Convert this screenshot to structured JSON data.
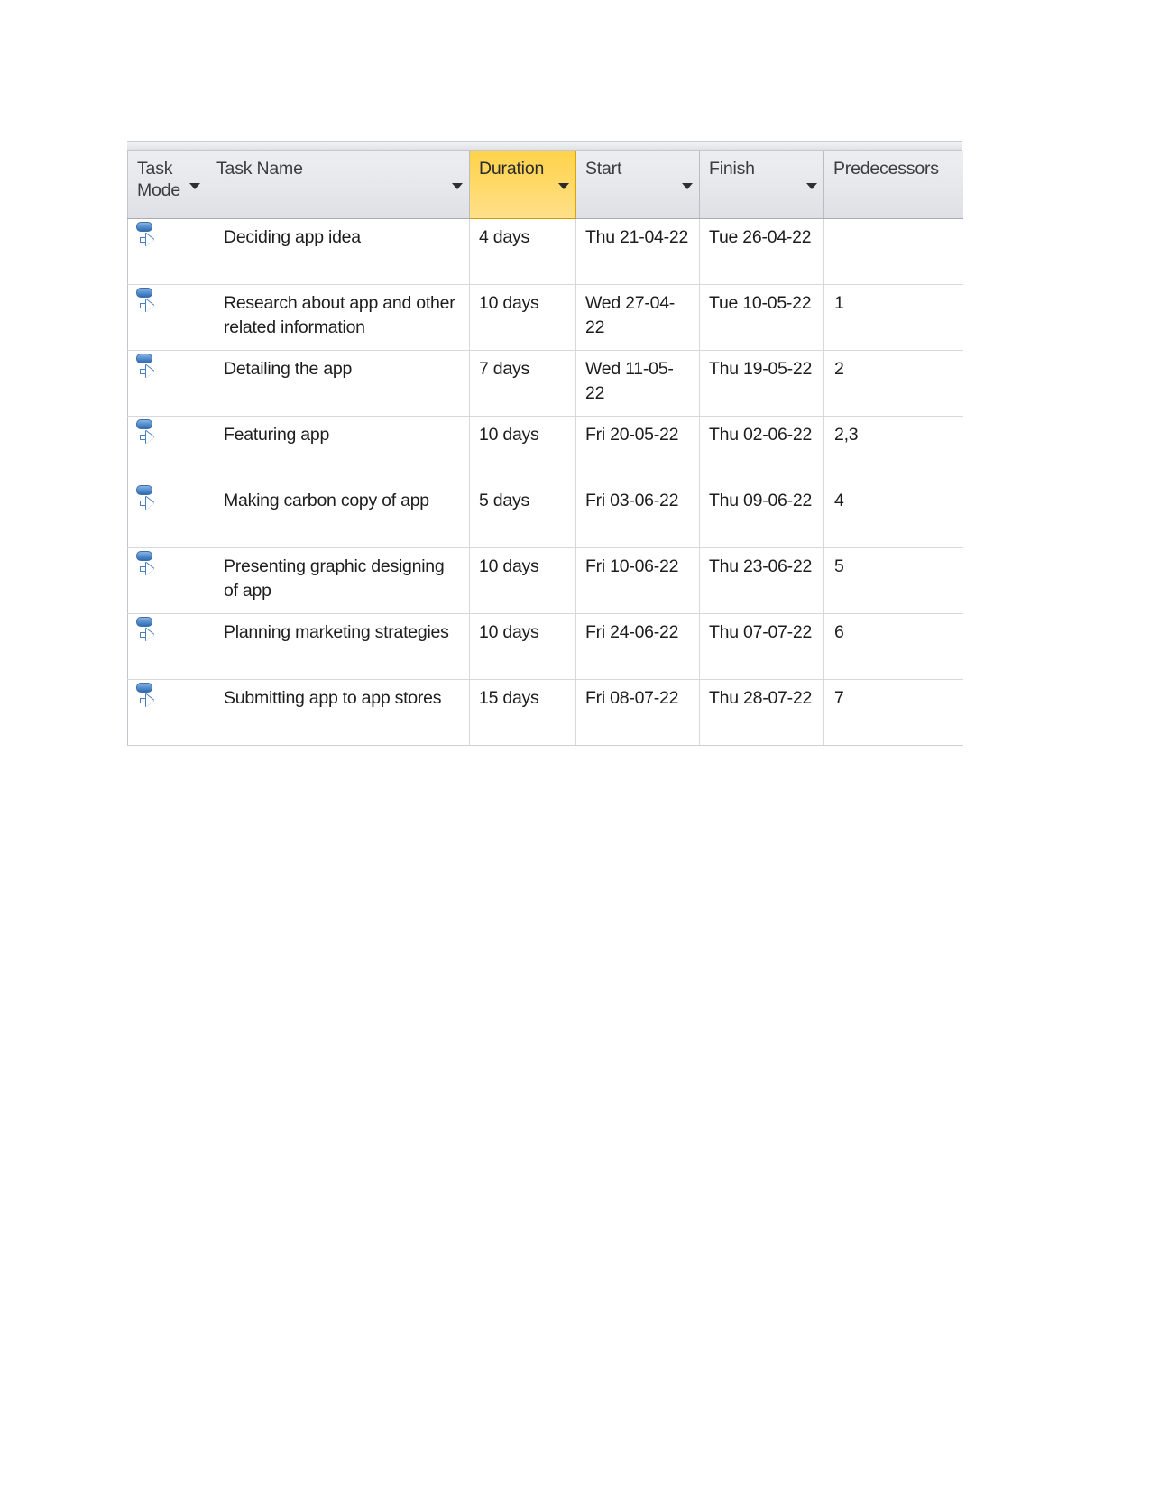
{
  "grid": {
    "columns": [
      {
        "key": "task_mode",
        "label": "Task Mode",
        "highlighted": false,
        "has_filter": true
      },
      {
        "key": "task_name",
        "label": "Task Name",
        "highlighted": false,
        "has_filter": true
      },
      {
        "key": "duration",
        "label": "Duration",
        "highlighted": true,
        "has_filter": true
      },
      {
        "key": "start",
        "label": "Start",
        "highlighted": false,
        "has_filter": true
      },
      {
        "key": "finish",
        "label": "Finish",
        "highlighted": false,
        "has_filter": true
      },
      {
        "key": "predecessors",
        "label": "Predecessors",
        "highlighted": false,
        "has_filter": true
      }
    ],
    "selected_column": "Duration",
    "accent_color": "#FFD24A",
    "header_background": "#E6E8EC",
    "gridline_color": "#D6D8DC",
    "task_mode_icon": "auto-scheduled-icon",
    "rows": [
      {
        "task_mode": "auto-scheduled-icon",
        "task_name": "Deciding app idea",
        "duration": "4 days",
        "start": "Thu 21-04-22",
        "finish": "Tue 26-04-22",
        "predecessors": ""
      },
      {
        "task_mode": "auto-scheduled-icon",
        "task_name": "Research about app and other related information",
        "duration": "10 days",
        "start": "Wed 27-04-22",
        "finish": "Tue 10-05-22",
        "predecessors": "1"
      },
      {
        "task_mode": "auto-scheduled-icon",
        "task_name": "Detailing the app",
        "duration": "7 days",
        "start": "Wed 11-05-22",
        "finish": "Thu 19-05-22",
        "predecessors": "2"
      },
      {
        "task_mode": "auto-scheduled-icon",
        "task_name": "Featuring app",
        "duration": "10 days",
        "start": "Fri 20-05-22",
        "finish": "Thu 02-06-22",
        "predecessors": "2,3"
      },
      {
        "task_mode": "auto-scheduled-icon",
        "task_name": "Making carbon copy of app",
        "duration": "5 days",
        "start": "Fri 03-06-22",
        "finish": "Thu 09-06-22",
        "predecessors": "4"
      },
      {
        "task_mode": "auto-scheduled-icon",
        "task_name": "Presenting graphic designing of app",
        "duration": "10 days",
        "start": "Fri 10-06-22",
        "finish": "Thu 23-06-22",
        "predecessors": "5"
      },
      {
        "task_mode": "auto-scheduled-icon",
        "task_name": "Planning marketing strategies",
        "duration": "10 days",
        "start": "Fri 24-06-22",
        "finish": "Thu 07-07-22",
        "predecessors": "6"
      },
      {
        "task_mode": "auto-scheduled-icon",
        "task_name": "Submitting app to app stores",
        "duration": "15 days",
        "start": "Fri 08-07-22",
        "finish": "Thu 28-07-22",
        "predecessors": "7"
      }
    ]
  }
}
